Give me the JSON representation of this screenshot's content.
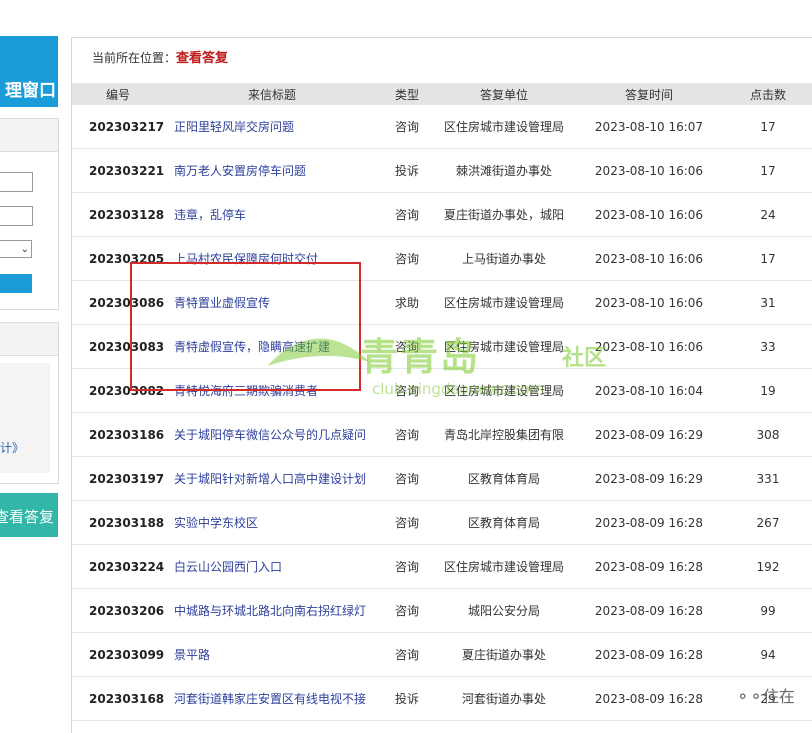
{
  "sidebar": {
    "banner_text": "理窗口",
    "link_text": "计》",
    "action_button": "查看答复"
  },
  "breadcrumb": {
    "prefix": "当前所在位置：",
    "current": "查看答复"
  },
  "table": {
    "headers": [
      "编号",
      "来信标题",
      "类型",
      "答复单位",
      "答复时间",
      "点击数"
    ],
    "rows": [
      {
        "id": "202303217",
        "title": "正阳里轻风岸交房问题",
        "type": "咨询",
        "unit": "区住房城市建设管理局",
        "time": "2023-08-10  16:07",
        "clicks": "17"
      },
      {
        "id": "202303221",
        "title": "南万老人安置房停车问题",
        "type": "投诉",
        "unit": "棘洪滩街道办事处",
        "time": "2023-08-10  16:06",
        "clicks": "17"
      },
      {
        "id": "202303128",
        "title": "违章，乱停车",
        "type": "咨询",
        "unit": "夏庄街道办事处，城阳",
        "time": "2023-08-10  16:06",
        "clicks": "24"
      },
      {
        "id": "202303205",
        "title": "上马村农民保障房何时交付",
        "type": "咨询",
        "unit": "上马街道办事处",
        "time": "2023-08-10  16:06",
        "clicks": "17"
      },
      {
        "id": "202303086",
        "title": "青特置业虚假宣传",
        "type": "求助",
        "unit": "区住房城市建设管理局",
        "time": "2023-08-10  16:06",
        "clicks": "31"
      },
      {
        "id": "202303083",
        "title": "青特虚假宣传，隐瞒高速扩建",
        "type": "咨询",
        "unit": "区住房城市建设管理局",
        "time": "2023-08-10  16:06",
        "clicks": "33"
      },
      {
        "id": "202303082",
        "title": "青特悦海府三期欺骗消费者",
        "type": "咨询",
        "unit": "区住房城市建设管理局",
        "time": "2023-08-10  16:04",
        "clicks": "19"
      },
      {
        "id": "202303186",
        "title": "关于城阳停车微信公众号的几点疑问",
        "type": "咨询",
        "unit": "青岛北岸控股集团有限",
        "time": "2023-08-09  16:29",
        "clicks": "308"
      },
      {
        "id": "202303197",
        "title": "关于城阳针对新增人口高中建设计划",
        "type": "咨询",
        "unit": "区教育体育局",
        "time": "2023-08-09  16:29",
        "clicks": "331"
      },
      {
        "id": "202303188",
        "title": "实验中学东校区",
        "type": "咨询",
        "unit": "区教育体育局",
        "time": "2023-08-09  16:28",
        "clicks": "267"
      },
      {
        "id": "202303224",
        "title": "白云山公园西门入口",
        "type": "咨询",
        "unit": "区住房城市建设管理局",
        "time": "2023-08-09  16:28",
        "clicks": "192"
      },
      {
        "id": "202303206",
        "title": "中城路与环城北路北向南右拐红绿灯",
        "type": "咨询",
        "unit": "城阳公安分局",
        "time": "2023-08-09  16:28",
        "clicks": "99"
      },
      {
        "id": "202303099",
        "title": "景平路",
        "type": "咨询",
        "unit": "夏庄街道办事处",
        "time": "2023-08-09  16:28",
        "clicks": "94"
      },
      {
        "id": "202303168",
        "title": "河套街道韩家庄安置区有线电视不接",
        "type": "投诉",
        "unit": "河套街道办事处",
        "time": "2023-08-09  16:28",
        "clicks": "29"
      }
    ]
  },
  "watermark": {
    "logo_text": "青青岛",
    "community": "社区",
    "url": "club.qingdaonews.com"
  },
  "corner_text": "住在",
  "colors": {
    "banner_blue": "#1a9cd8",
    "teal": "#31b6a8",
    "crumb_red": "#c01a1a",
    "title_link": "#2d3f9c",
    "highlight_box": "#d42a2a",
    "watermark_green": "#78c828"
  }
}
